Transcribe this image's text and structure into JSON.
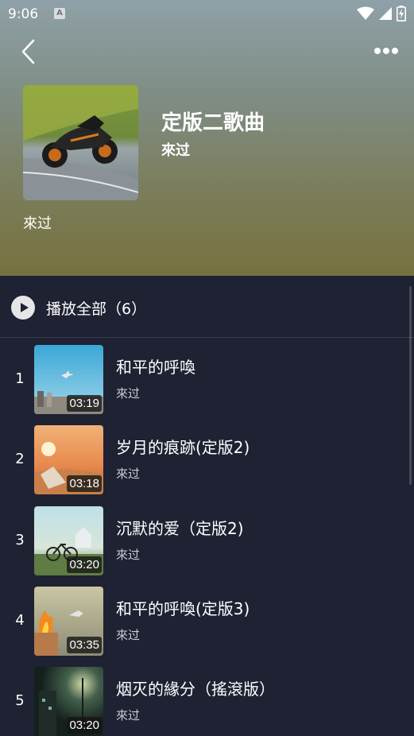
{
  "status_bar": {
    "time": "9:06",
    "notification_icon": "A"
  },
  "header": {
    "album_title": "定版二歌曲",
    "album_artist": "來过",
    "description": "來过"
  },
  "play_all": {
    "label": "播放全部（6）"
  },
  "songs": [
    {
      "index": "1",
      "title": "和平的呼喚",
      "artist": "來过",
      "duration": "03:19"
    },
    {
      "index": "2",
      "title": "岁月的痕跡(定版2)",
      "artist": "來过",
      "duration": "03:18"
    },
    {
      "index": "3",
      "title": "沉默的爱（定版2)",
      "artist": "來过",
      "duration": "03:20"
    },
    {
      "index": "4",
      "title": "和平的呼喚(定版3)",
      "artist": "來过",
      "duration": "03:35"
    },
    {
      "index": "5",
      "title": "烟灭的緣分（搖滾版）",
      "artist": "來过",
      "duration": "03:20"
    }
  ],
  "icons": {
    "back": "chevron-left-icon",
    "more": "more-dots-icon",
    "play": "play-icon",
    "wifi": "wifi-icon",
    "signal": "signal-icon",
    "battery": "battery-charging-icon"
  }
}
